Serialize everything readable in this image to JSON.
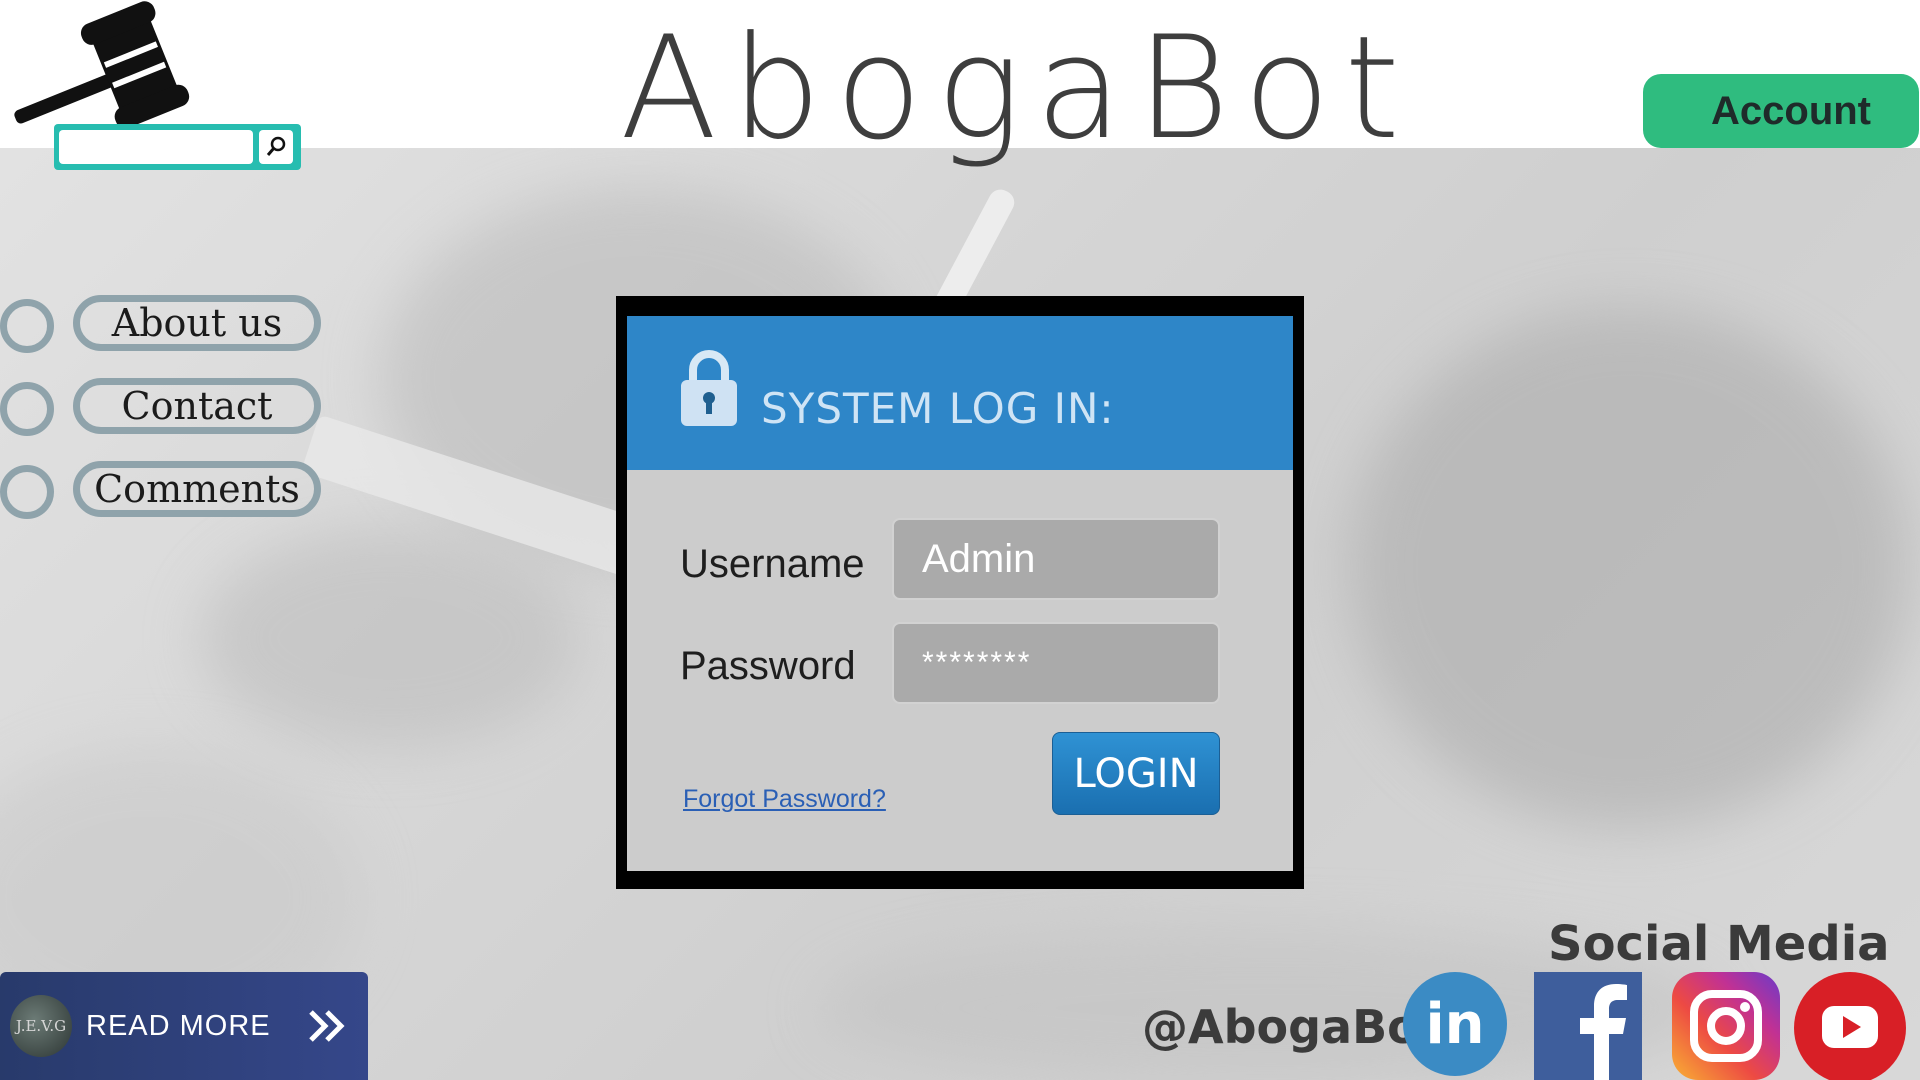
{
  "header": {
    "logo_text": "AbogaBot",
    "account_label": "Account",
    "search": {
      "placeholder": ""
    }
  },
  "nav": {
    "items": [
      {
        "label": "About us"
      },
      {
        "label": "Contact"
      },
      {
        "label": "Comments"
      }
    ]
  },
  "login": {
    "title": "SYSTEM LOG IN:",
    "username_label": "Username",
    "username_value": "Admin",
    "password_label": "Password",
    "password_value": "********",
    "login_label": "LOGIN",
    "forgot_label": "Forgot Password?"
  },
  "read_more": {
    "label": "READ MORE",
    "avatar_text": "J.E.V.G"
  },
  "social": {
    "title": "Social Media",
    "handle": "@AbogaBot",
    "icons": [
      "linkedin-icon",
      "facebook-icon",
      "instagram-icon",
      "youtube-icon"
    ]
  },
  "colors": {
    "account": "#2fbc7f",
    "search": "#27bdb0",
    "login_header": "#2e86c8",
    "login_button": "#1f7bbf",
    "read_more": "#2e4079"
  }
}
